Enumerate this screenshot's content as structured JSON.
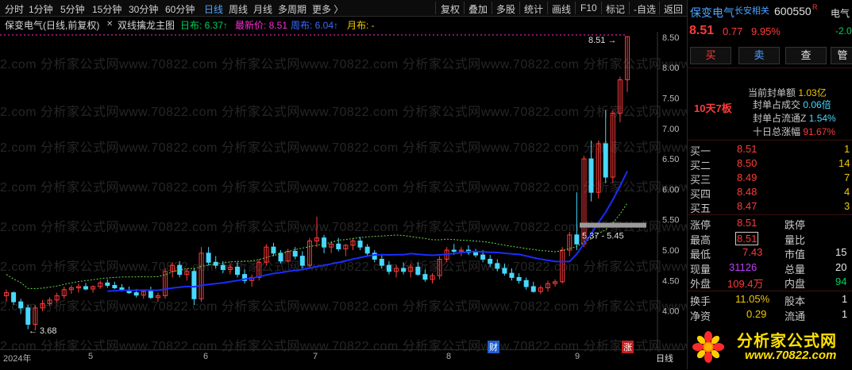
{
  "topbar": {
    "periods": [
      "分时",
      "1分钟",
      "5分钟",
      "15分钟",
      "30分钟",
      "60分钟",
      "日线",
      "周线",
      "月线",
      "多周期",
      "更多 〉"
    ],
    "active": "日线",
    "tools": [
      "复权",
      "叠加",
      "多股",
      "统计",
      "画线",
      "F10",
      "标记",
      "-自选",
      "返回"
    ]
  },
  "chart_title": {
    "stock": "保变电气(日线,前复权)",
    "indicator": "双线擒龙主图",
    "daily_label": "日布: 6.37↑",
    "latest_label": "最新价: 8.51",
    "weekly_label": "周布: 6.04↑",
    "monthly_label": "月布: -"
  },
  "chart": {
    "watermark": "2.com 分析家公式网www.70822.com 分析家公式网www.70822.com 分析家公式网www.70822.com 分析家公式网www.70822.com",
    "yaxis": [
      "8.50",
      "8.00",
      "7.50",
      "7.00",
      "6.50",
      "6.00",
      "5.50",
      "5.00",
      "4.50",
      "4.00"
    ],
    "high_label": "8.51",
    "low_label": "3.68",
    "band_label": "5.37 - 5.45",
    "colors": {
      "up": "#ff3b3b",
      "down": "#48d8ff",
      "blue_line": "#1a2cff",
      "green_line": "#6bd94a",
      "magenta": "#ff2bd6"
    },
    "candles": [
      [
        4.25,
        4.35,
        4.15,
        4.3
      ],
      [
        4.3,
        4.32,
        4.1,
        4.15
      ],
      [
        4.15,
        4.2,
        3.95,
        4.05
      ],
      [
        4.05,
        4.1,
        3.7,
        3.78
      ],
      [
        3.78,
        4.1,
        3.68,
        4.05
      ],
      [
        4.05,
        4.18,
        4.0,
        4.12
      ],
      [
        4.12,
        4.22,
        4.08,
        4.18
      ],
      [
        4.18,
        4.3,
        4.14,
        4.25
      ],
      [
        4.25,
        4.4,
        4.2,
        4.35
      ],
      [
        4.35,
        4.42,
        4.28,
        4.38
      ],
      [
        4.38,
        4.45,
        4.3,
        4.4
      ],
      [
        4.4,
        4.46,
        4.34,
        4.36
      ],
      [
        4.36,
        4.42,
        4.3,
        4.4
      ],
      [
        4.4,
        4.5,
        4.36,
        4.46
      ],
      [
        4.46,
        4.52,
        4.38,
        4.42
      ],
      [
        4.42,
        4.48,
        4.36,
        4.38
      ],
      [
        4.38,
        4.44,
        4.32,
        4.34
      ],
      [
        4.34,
        4.4,
        4.28,
        4.3
      ],
      [
        4.3,
        4.36,
        4.22,
        4.26
      ],
      [
        4.26,
        4.34,
        4.2,
        4.32
      ],
      [
        4.32,
        4.4,
        4.2,
        4.22
      ],
      [
        4.22,
        4.3,
        4.15,
        4.25
      ],
      [
        4.25,
        4.7,
        4.2,
        4.65
      ],
      [
        4.65,
        4.8,
        4.55,
        4.75
      ],
      [
        4.75,
        4.82,
        4.55,
        4.6
      ],
      [
        4.6,
        4.7,
        4.5,
        4.65
      ],
      [
        4.65,
        4.7,
        4.1,
        4.2
      ],
      [
        4.2,
        5.05,
        4.15,
        4.95
      ],
      [
        4.95,
        5.05,
        4.75,
        4.8
      ],
      [
        4.8,
        4.9,
        4.7,
        4.75
      ],
      [
        4.75,
        4.82,
        4.62,
        4.68
      ],
      [
        4.68,
        4.78,
        4.6,
        4.72
      ],
      [
        4.72,
        4.8,
        4.55,
        4.6
      ],
      [
        4.6,
        4.68,
        4.45,
        4.5
      ],
      [
        4.5,
        4.6,
        4.4,
        4.55
      ],
      [
        4.55,
        4.85,
        4.5,
        4.8
      ],
      [
        4.8,
        5.1,
        4.75,
        5.05
      ],
      [
        5.05,
        5.12,
        4.9,
        4.95
      ],
      [
        4.95,
        5.0,
        4.78,
        4.82
      ],
      [
        4.82,
        5.02,
        4.8,
        4.98
      ],
      [
        4.98,
        5.05,
        4.85,
        4.9
      ],
      [
        4.9,
        4.98,
        4.7,
        4.75
      ],
      [
        4.75,
        5.2,
        4.7,
        5.15
      ],
      [
        5.15,
        5.55,
        5.05,
        5.2
      ],
      [
        5.2,
        5.25,
        4.95,
        5.05
      ],
      [
        5.05,
        5.15,
        4.95,
        5.1
      ],
      [
        5.1,
        5.2,
        4.98,
        5.02
      ],
      [
        5.02,
        5.1,
        4.9,
        5.08
      ],
      [
        5.08,
        5.2,
        5.0,
        5.15
      ],
      [
        5.15,
        5.22,
        5.0,
        5.05
      ],
      [
        5.05,
        5.1,
        4.9,
        4.95
      ],
      [
        4.95,
        5.0,
        4.8,
        4.85
      ],
      [
        4.85,
        4.92,
        4.7,
        4.75
      ],
      [
        4.75,
        4.82,
        4.6,
        4.65
      ],
      [
        4.65,
        4.75,
        4.55,
        4.7
      ],
      [
        4.7,
        4.8,
        4.6,
        4.65
      ],
      [
        4.65,
        4.78,
        4.55,
        4.72
      ],
      [
        4.72,
        4.8,
        4.58,
        4.6
      ],
      [
        4.6,
        4.68,
        4.48,
        4.52
      ],
      [
        4.52,
        4.62,
        4.45,
        4.58
      ],
      [
        4.58,
        4.9,
        4.52,
        4.85
      ],
      [
        4.85,
        5.05,
        4.8,
        5.0
      ],
      [
        5.0,
        5.1,
        4.92,
        4.98
      ],
      [
        4.98,
        5.05,
        4.9,
        5.0
      ],
      [
        5.0,
        5.08,
        4.92,
        4.96
      ],
      [
        4.96,
        5.02,
        4.88,
        4.92
      ],
      [
        4.92,
        5.0,
        4.8,
        4.85
      ],
      [
        4.85,
        4.92,
        4.72,
        4.78
      ],
      [
        4.78,
        4.85,
        4.65,
        4.7
      ],
      [
        4.7,
        4.78,
        4.58,
        4.62
      ],
      [
        4.62,
        4.7,
        4.5,
        4.55
      ],
      [
        4.55,
        4.62,
        4.45,
        4.5
      ],
      [
        4.5,
        4.55,
        4.35,
        4.4
      ],
      [
        4.4,
        4.48,
        4.3,
        4.32
      ],
      [
        4.32,
        4.42,
        4.28,
        4.38
      ],
      [
        4.38,
        4.5,
        4.32,
        4.45
      ],
      [
        4.45,
        4.52,
        4.4,
        4.48
      ],
      [
        4.48,
        5.05,
        4.45,
        5.0
      ],
      [
        5.0,
        5.3,
        4.9,
        5.25
      ],
      [
        5.25,
        5.95,
        5.0,
        5.1
      ],
      [
        5.1,
        6.55,
        5.05,
        6.5
      ],
      [
        6.5,
        6.8,
        5.8,
        5.95
      ],
      [
        5.95,
        6.8,
        5.85,
        6.75
      ],
      [
        6.75,
        7.3,
        6.1,
        6.2
      ],
      [
        6.2,
        7.3,
        6.1,
        7.25
      ],
      [
        7.25,
        7.85,
        7.1,
        7.8
      ],
      [
        7.8,
        8.51,
        7.6,
        8.51
      ]
    ]
  },
  "dates": [
    "2024年",
    "5",
    "6",
    "7",
    "8",
    "9",
    "日线"
  ],
  "date_markers": {
    "cai": "财",
    "zhang": "涨"
  },
  "right": {
    "name": "保变电气",
    "tag": "长安相关",
    "code": "600550",
    "rq": "R",
    "price": "8.51",
    "change": "0.77",
    "pct": "9.95%",
    "buttons": [
      "买",
      "卖",
      "查",
      "管"
    ],
    "badge": "10天7板",
    "seal": [
      {
        "label": "当前封单额",
        "value": "1.03亿"
      },
      {
        "label": "封单占成交",
        "value": "0.06倍"
      },
      {
        "label": "封单占流通Z",
        "value": "1.54%"
      },
      {
        "label": "十日总涨幅",
        "value": "91.67%"
      }
    ],
    "bids": [
      {
        "label": "买一",
        "price": "8.51",
        "vol": "1"
      },
      {
        "label": "买二",
        "price": "8.50",
        "vol": "14"
      },
      {
        "label": "买三",
        "price": "8.49",
        "vol": "7"
      },
      {
        "label": "买四",
        "price": "8.48",
        "vol": "4"
      },
      {
        "label": "买五",
        "price": "8.47",
        "vol": "3"
      }
    ],
    "stats": [
      {
        "k1": "涨停",
        "v1": "8.51",
        "k2": "跌停",
        "v2": ""
      },
      {
        "k1": "最高",
        "v1": "8.51",
        "k2": "量比",
        "v2": ""
      },
      {
        "k1": "最低",
        "v1": "7.43",
        "k2": "市值",
        "v2": "15"
      },
      {
        "k1": "现量",
        "v1": "31126",
        "k2": "总量",
        "v2": "20"
      },
      {
        "k1": "外盘",
        "v1": "109.4万",
        "k2": "内盘",
        "v2": "94"
      }
    ],
    "stats2": [
      {
        "k1": "换手",
        "v1": "11.05%",
        "k2": "股本",
        "v2": "1"
      },
      {
        "k1": "净资",
        "v1": "0.29",
        "k2": "流通",
        "v2": "1"
      }
    ],
    "side_change": "-2.0",
    "side_name": "电气",
    "logo_text": "分析家公式网",
    "logo_url": "www.70822.com"
  }
}
